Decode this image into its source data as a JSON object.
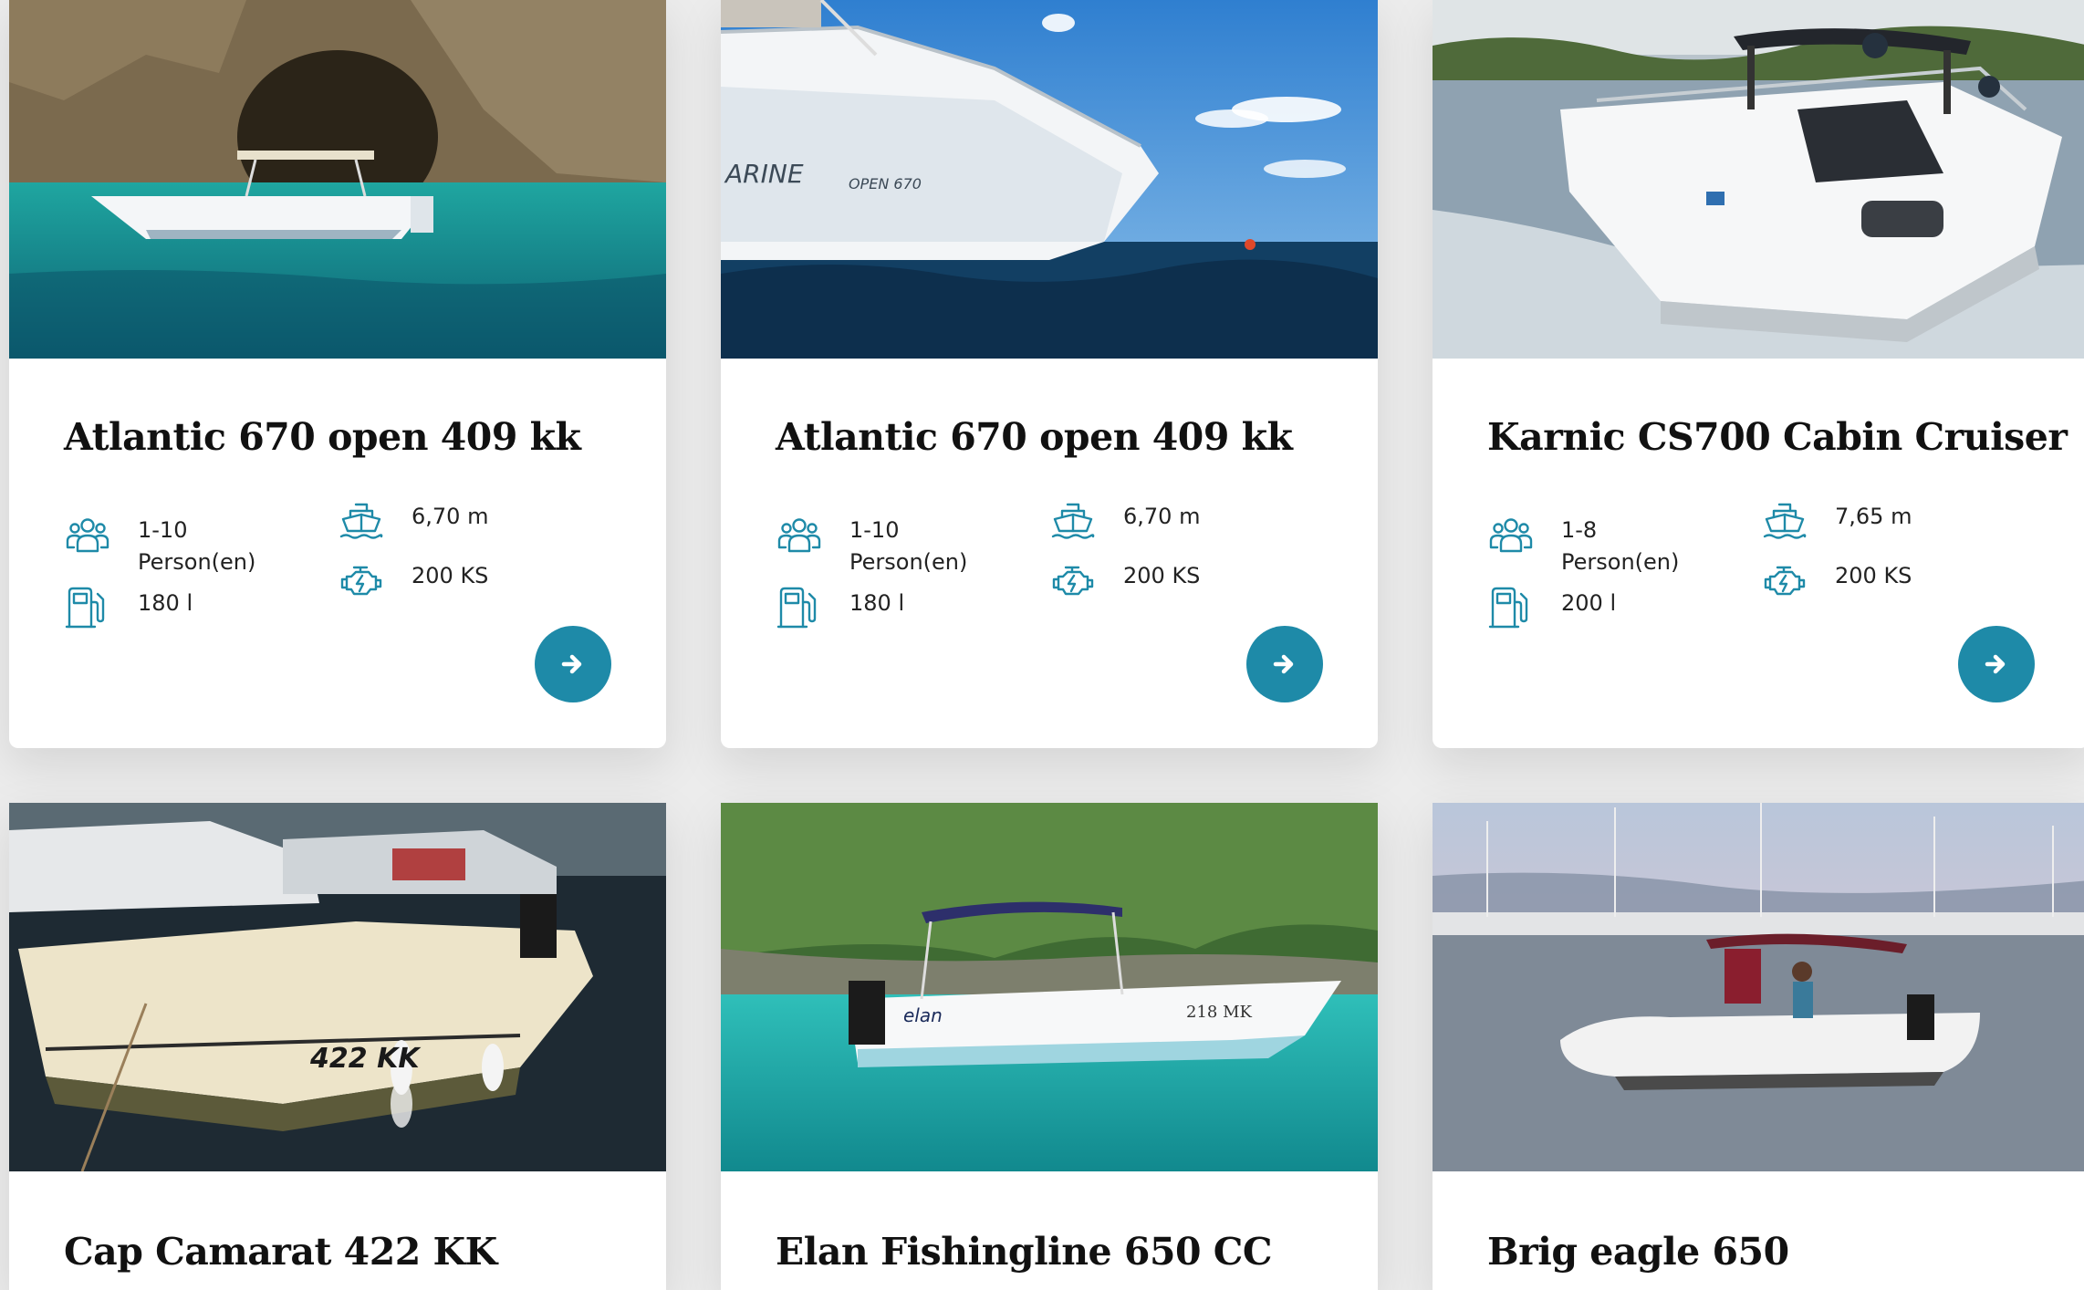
{
  "colors": {
    "accent": "#1e8aa8",
    "background": "#ececec",
    "card": "#ffffff",
    "title": "#111111"
  },
  "icons": {
    "persons": "people-group-icon",
    "length": "boat-icon",
    "fuel": "fuel-pump-icon",
    "engine": "engine-icon",
    "arrow": "arrow-right-icon"
  },
  "boats": [
    {
      "name": "Atlantic 670 open 409 kk",
      "persons": "1-10",
      "persons_unit": "Person(en)",
      "length": "6,70 m",
      "power": "200 KS",
      "fuel": "180 l"
    },
    {
      "name": "Atlantic 670 open 409 kk",
      "persons": "1-10",
      "persons_unit": "Person(en)",
      "length": "6,70 m",
      "power": "200 KS",
      "fuel": "180 l"
    },
    {
      "name": "Karnic CS700 Cabin Cruiser",
      "persons": "1-8",
      "persons_unit": "Person(en)",
      "length": "7,65 m",
      "power": "200 KS",
      "fuel": "200 l"
    },
    {
      "name": "Cap Camarat 422 KK"
    },
    {
      "name": "Elan Fishingline 650 CC"
    },
    {
      "name": "Brig eagle 650"
    }
  ]
}
